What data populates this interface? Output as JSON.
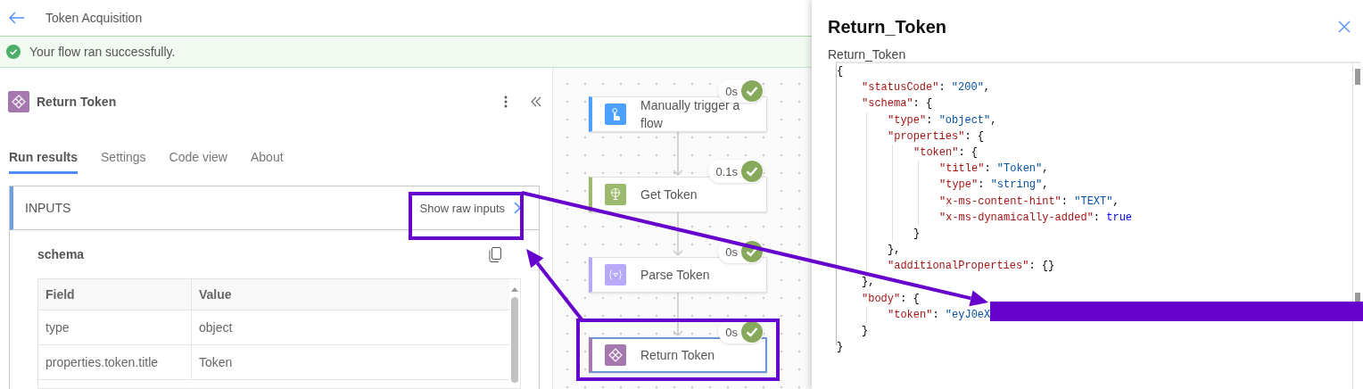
{
  "header": {
    "title": "Token Acquisition"
  },
  "banner": {
    "message": "Your flow ran successfully.",
    "succeeded": true
  },
  "action_panel": {
    "title": "Return Token",
    "tabs": [
      {
        "label": "Run results",
        "selected": true
      },
      {
        "label": "Settings",
        "selected": false
      },
      {
        "label": "Code view",
        "selected": false
      },
      {
        "label": "About",
        "selected": false
      }
    ],
    "inputs": {
      "heading": "INPUTS",
      "raw_link": "Show raw inputs",
      "section_title": "schema",
      "table": {
        "columns": [
          "Field",
          "Value"
        ],
        "rows": [
          [
            "type",
            "object"
          ],
          [
            "properties.token.title",
            "Token"
          ]
        ]
      }
    }
  },
  "canvas": {
    "steps": [
      {
        "title": "Manually trigger a flow",
        "duration": "0s",
        "succeeded": true,
        "kind": "trigger",
        "selected": false
      },
      {
        "title": "Get Token",
        "duration": "0.1s",
        "succeeded": true,
        "kind": "http",
        "selected": false
      },
      {
        "title": "Parse Token",
        "duration": "0s",
        "succeeded": true,
        "kind": "parse",
        "selected": false
      },
      {
        "title": "Return Token",
        "duration": "0s",
        "succeeded": true,
        "kind": "response",
        "selected": true
      }
    ]
  },
  "raw_panel": {
    "title": "Return_Token",
    "subtitle": "Return_Token",
    "code_lines": [
      {
        "segments": [
          {
            "kind": "punct",
            "text": "{"
          }
        ],
        "children": [
          {
            "segments": [
              {
                "kind": "key",
                "text": "\"statusCode\""
              },
              {
                "kind": "punct",
                "text": ": "
              },
              {
                "kind": "string",
                "text": "\"200\""
              },
              {
                "kind": "punct",
                "text": ","
              }
            ]
          },
          {
            "segments": [
              {
                "kind": "key",
                "text": "\"schema\""
              },
              {
                "kind": "punct",
                "text": ": {"
              }
            ],
            "children": [
              {
                "segments": [
                  {
                    "kind": "key",
                    "text": "\"type\""
                  },
                  {
                    "kind": "punct",
                    "text": ": "
                  },
                  {
                    "kind": "string",
                    "text": "\"object\""
                  },
                  {
                    "kind": "punct",
                    "text": ","
                  }
                ]
              },
              {
                "segments": [
                  {
                    "kind": "key",
                    "text": "\"properties\""
                  },
                  {
                    "kind": "punct",
                    "text": ": {"
                  }
                ],
                "children": [
                  {
                    "segments": [
                      {
                        "kind": "key",
                        "text": "\"token\""
                      },
                      {
                        "kind": "punct",
                        "text": ": {"
                      }
                    ],
                    "children": [
                      {
                        "segments": [
                          {
                            "kind": "key",
                            "text": "\"title\""
                          },
                          {
                            "kind": "punct",
                            "text": ": "
                          },
                          {
                            "kind": "string",
                            "text": "\"Token\""
                          },
                          {
                            "kind": "punct",
                            "text": ","
                          }
                        ]
                      },
                      {
                        "segments": [
                          {
                            "kind": "key",
                            "text": "\"type\""
                          },
                          {
                            "kind": "punct",
                            "text": ": "
                          },
                          {
                            "kind": "string",
                            "text": "\"string\""
                          },
                          {
                            "kind": "punct",
                            "text": ","
                          }
                        ]
                      },
                      {
                        "segments": [
                          {
                            "kind": "key",
                            "text": "\"x-ms-content-hint\""
                          },
                          {
                            "kind": "punct",
                            "text": ": "
                          },
                          {
                            "kind": "string",
                            "text": "\"TEXT\""
                          },
                          {
                            "kind": "punct",
                            "text": ","
                          }
                        ]
                      },
                      {
                        "segments": [
                          {
                            "kind": "key",
                            "text": "\"x-ms-dynamically-added\""
                          },
                          {
                            "kind": "punct",
                            "text": ": "
                          },
                          {
                            "kind": "literal",
                            "text": "true"
                          }
                        ]
                      }
                    ]
                  },
                  {
                    "segments": [
                      {
                        "kind": "punct",
                        "text": "}"
                      }
                    ]
                  }
                ]
              },
              {
                "segments": [
                  {
                    "kind": "punct",
                    "text": "},"
                  }
                ]
              },
              {
                "segments": [
                  {
                    "kind": "key",
                    "text": "\"additionalProperties\""
                  },
                  {
                    "kind": "punct",
                    "text": ": {}"
                  }
                ]
              }
            ]
          },
          {
            "segments": [
              {
                "kind": "punct",
                "text": "},"
              }
            ]
          },
          {
            "segments": [
              {
                "kind": "key",
                "text": "\"body\""
              },
              {
                "kind": "punct",
                "text": ": {"
              }
            ],
            "children": [
              {
                "segments": [
                  {
                    "kind": "key",
                    "text": "\"token\""
                  },
                  {
                    "kind": "punct",
                    "text": ": "
                  },
                  {
                    "kind": "string",
                    "text": "\"eyJ0eX"
                  }
                ]
              }
            ]
          },
          {
            "segments": [
              {
                "kind": "punct",
                "text": "}"
              }
            ]
          }
        ]
      },
      {
        "segments": [
          {
            "kind": "punct",
            "text": "}"
          }
        ]
      }
    ]
  }
}
